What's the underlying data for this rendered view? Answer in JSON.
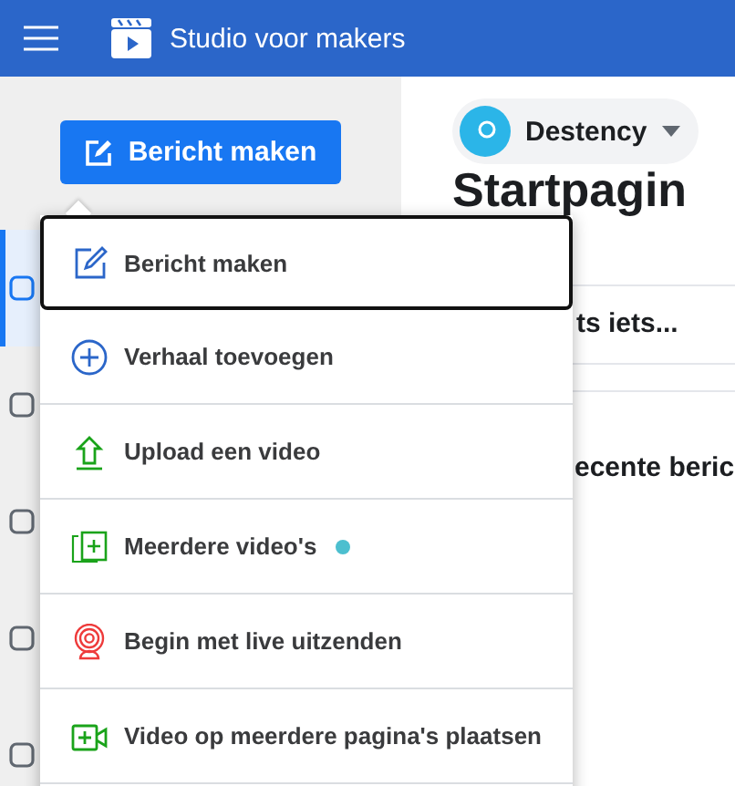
{
  "header": {
    "title": "Studio voor makers"
  },
  "sidebar": {
    "create_button": "Bericht maken",
    "items": [
      {
        "selected": true
      },
      {
        "selected": false
      },
      {
        "selected": false
      },
      {
        "selected": false
      },
      {
        "selected": false
      }
    ]
  },
  "page_switcher": {
    "name": "Destency"
  },
  "main": {
    "heading": "Startpagin",
    "post_prompt": "ts iets...",
    "section_title": "ecente beric"
  },
  "create_menu": {
    "items": [
      {
        "kind": "edit",
        "label": "Bericht maken",
        "selected": true,
        "new": false
      },
      {
        "kind": "add",
        "label": "Verhaal toevoegen",
        "selected": false,
        "new": false
      },
      {
        "kind": "upload",
        "label": "Upload een video",
        "selected": false,
        "new": false
      },
      {
        "kind": "multi",
        "label": "Meerdere video's",
        "selected": false,
        "new": true
      },
      {
        "kind": "live",
        "label": "Begin met live uitzenden",
        "selected": false,
        "new": false
      },
      {
        "kind": "crosspost",
        "label": "Video op meerdere pagina's plaatsen",
        "selected": false,
        "new": false
      }
    ]
  }
}
